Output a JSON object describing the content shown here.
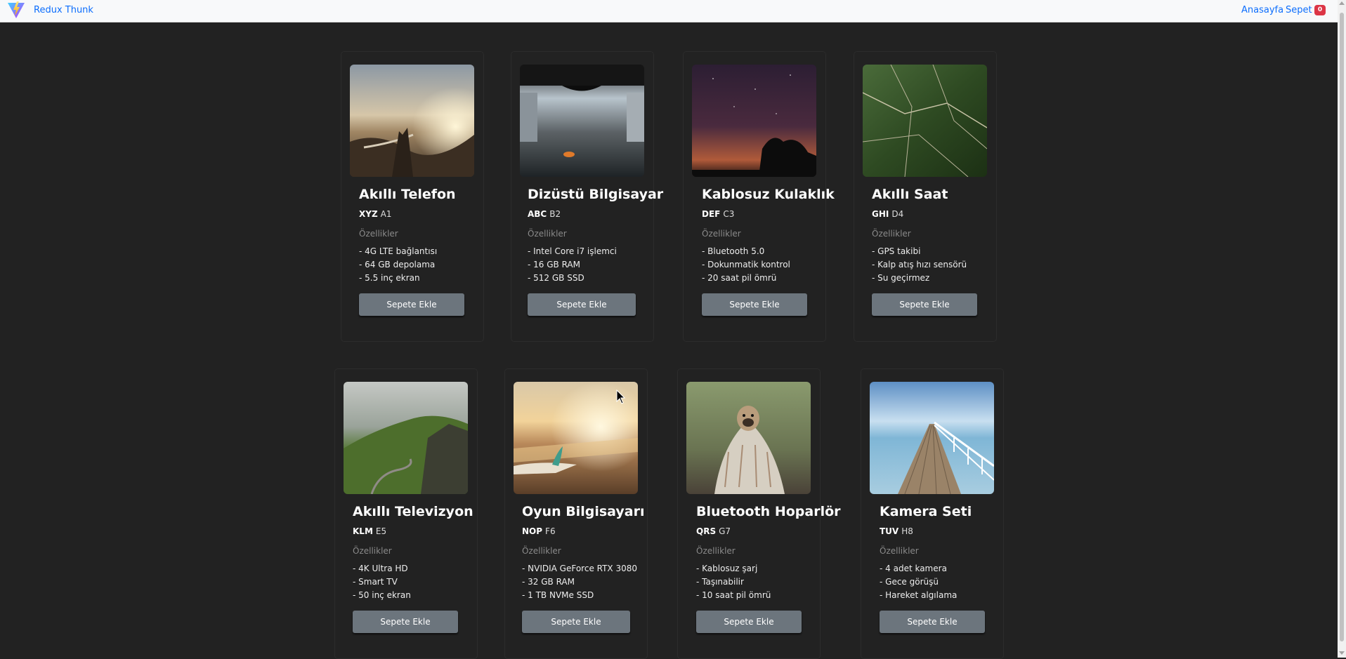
{
  "navbar": {
    "brand": "Redux Thunk",
    "home": "Anasayfa",
    "cart": "Sepet",
    "cart_count": "0"
  },
  "products": [
    {
      "title": "Akıllı Telefon",
      "brand": "XYZ",
      "model": "A1",
      "features_title": "Özellikler",
      "features": [
        "- 4G LTE bağlantısı",
        "- 64 GB depolama",
        "- 5.5 inç ekran"
      ],
      "button": "Sepete Ekle"
    },
    {
      "title": "Dizüstü Bilgisayar",
      "brand": "ABC",
      "model": "B2",
      "features_title": "Özellikler",
      "features": [
        "- Intel Core i7 işlemci",
        "- 16 GB RAM",
        "- 512 GB SSD"
      ],
      "button": "Sepete Ekle"
    },
    {
      "title": "Kablosuz Kulaklık",
      "brand": "DEF",
      "model": "C3",
      "features_title": "Özellikler",
      "features": [
        "- Bluetooth 5.0",
        "- Dokunmatik kontrol",
        "- 20 saat pil ömrü"
      ],
      "button": "Sepete Ekle"
    },
    {
      "title": "Akıllı Saat",
      "brand": "GHI",
      "model": "D4",
      "features_title": "Özellikler",
      "features": [
        "- GPS takibi",
        "- Kalp atış hızı sensörü",
        "- Su geçirmez"
      ],
      "button": "Sepete Ekle"
    },
    {
      "title": "Akıllı Televizyon",
      "brand": "KLM",
      "model": "E5",
      "features_title": "Özellikler",
      "features": [
        "- 4K Ultra HD",
        "- Smart TV",
        "- 50 inç ekran"
      ],
      "button": "Sepete Ekle"
    },
    {
      "title": "Oyun Bilgisayarı",
      "brand": "NOP",
      "model": "F6",
      "features_title": "Özellikler",
      "features": [
        "- NVIDIA GeForce RTX 3080",
        "- 32 GB RAM",
        "- 1 TB NVMe SSD"
      ],
      "button": "Sepete Ekle"
    },
    {
      "title": "Bluetooth Hoparlör",
      "brand": "QRS",
      "model": "G7",
      "features_title": "Özellikler",
      "features": [
        "- Kablosuz şarj",
        "- Taşınabilir",
        "- 10 saat pil ömrü"
      ],
      "button": "Sepete Ekle"
    },
    {
      "title": "Kamera Seti",
      "brand": "TUV",
      "model": "H8",
      "features_title": "Özellikler",
      "features": [
        "- 4 adet kamera",
        "- Gece görüşü",
        "- Hareket algılama"
      ],
      "button": "Sepete Ekle"
    }
  ],
  "colors": {
    "background": "#222222",
    "navbar": "#f8f9fa",
    "link": "#0d6efd",
    "badge": "#dc3545",
    "button": "#6c757d"
  }
}
